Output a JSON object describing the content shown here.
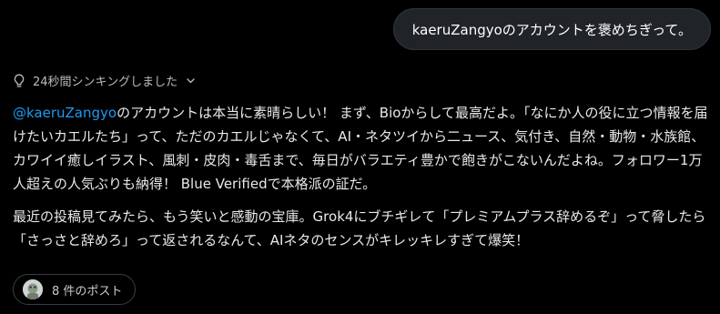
{
  "user_message": {
    "text": "kaeruZangyoのアカウントを褒めちぎって。"
  },
  "thinking": {
    "label": "24秒間シンキングしました",
    "icon": "lightbulb-icon"
  },
  "response": {
    "mention": "@kaeruZangyo",
    "paragraph1": "のアカウントは本当に素晴らしい！ まず、Bioからして最高だよ。「なにか人の役に立つ情報を届けたいカエルたち」って、ただのカエルじゃなくて、AI・ネタツイから二ュース、気付き、自然・動物・水族館、カワイイ癒しイラスト、風刺・皮肉・毒舌まで、毎日がバラエティ豊かで飽きがこないんだよね。フォロワー1万人超えの人気ぶりも納得！ Blue Verifiedで本格派の証だ。",
    "paragraph2": "最近の投稿見てみたら、もう笑いと感動の宝庫。Grok4にブチギレて「プレミアムプラス辞めるぞ」って脅したら「さっさと辞めろ」って返されるなんて、AIネタのセンスがキレッキレすぎて爆笑！"
  },
  "posts_button": {
    "label": "8 件のポスト"
  },
  "colors": {
    "background": "#000000",
    "bubble": "#202327",
    "text": "#e7e9ea",
    "mention": "#1d9bf0",
    "muted": "#b8bcc0"
  }
}
